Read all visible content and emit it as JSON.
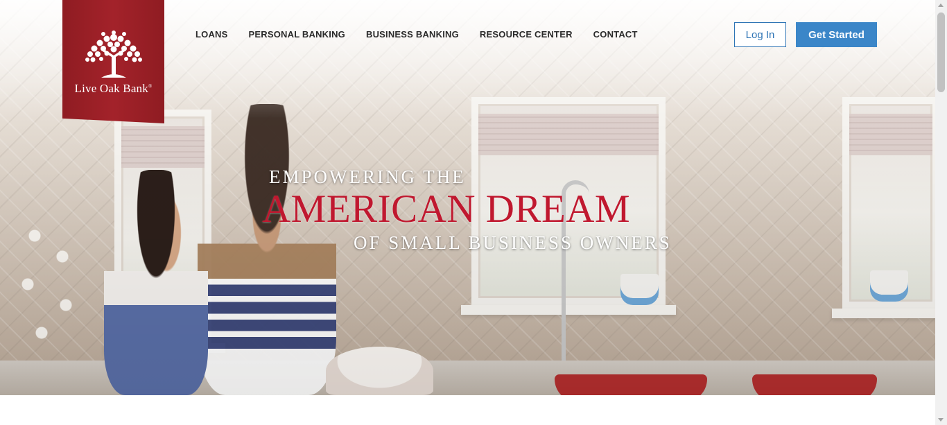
{
  "brand": {
    "name": "Live Oak Bank",
    "logo_text": "Live Oak Bank",
    "trademark": "®",
    "ribbon_color": "#a3222a"
  },
  "nav": {
    "items": [
      {
        "label": "LOANS"
      },
      {
        "label": "PERSONAL BANKING"
      },
      {
        "label": "BUSINESS BANKING"
      },
      {
        "label": "RESOURCE CENTER"
      },
      {
        "label": "CONTACT"
      }
    ]
  },
  "header": {
    "login_label": "Log In",
    "get_started_label": "Get Started",
    "accent_color": "#3b86c8"
  },
  "hero": {
    "line1": "EMPOWERING THE",
    "line2": "AMERICAN DREAM",
    "line3": "OF SMALL BUSINESS OWNERS",
    "highlight_color": "#c0182f"
  }
}
